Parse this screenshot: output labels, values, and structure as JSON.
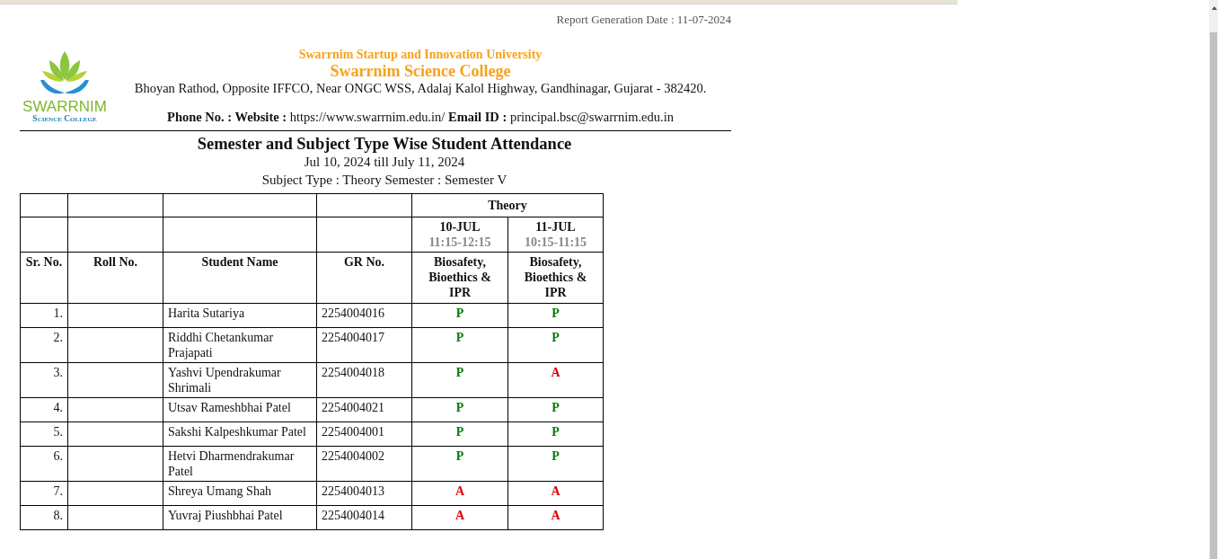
{
  "report_date": "Report Generation Date : 11-07-2024",
  "logo": {
    "line_1": "SWARRNIM",
    "line_2": "Science College"
  },
  "header": {
    "university": "Swarrnim Startup and Innovation University",
    "college": "Swarrnim Science College",
    "address": "Bhoyan Rathod, Opposite IFFCO, Near ONGC WSS, Adalaj Kalol Highway, Gandhinagar, Gujarat - 382420.",
    "contact": "**Phone No. :  Website :** https://www.swarrnim.edu.in/ **Email ID :** principal.bsc@swarrnim.edu.in"
  },
  "title": "Semester and Subject Type Wise Student Attendance",
  "date_range": "Jul 10, 2024 till July 11, 2024",
  "subtitle": "Subject Type : Theory Semester : Semester V",
  "table": {
    "group": "Theory",
    "sessions": [
      {
        "date": "10-JUL",
        "time": "11:15-12:15",
        "subject": "Biosafety, Bioethics & IPR"
      },
      {
        "date": "11-JUL",
        "time": "10:15-11:15",
        "subject": "Biosafety, Bioethics & IPR"
      }
    ],
    "columns": [
      "Sr. No.",
      "Roll No.",
      "Student Name",
      "GR No."
    ],
    "rows": [
      {
        "sr": "1.",
        "name": "Harita  Sutariya",
        "gr": "2254004016",
        "marks": [
          {
            "text": "P",
            "kind": "present"
          },
          {
            "text": "P",
            "kind": "present"
          }
        ]
      },
      {
        "sr": "2.",
        "name": "Riddhi Chetankumar Prajapati",
        "gr": "2254004017",
        "marks": [
          {
            "text": "P",
            "kind": "present"
          },
          {
            "text": "P",
            "kind": "present"
          }
        ]
      },
      {
        "sr": "3.",
        "name": "Yashvi Upendrakumar Shrimali",
        "gr": "2254004018",
        "marks": [
          {
            "text": "P",
            "kind": "present"
          },
          {
            "text": "A",
            "kind": "absent"
          }
        ]
      },
      {
        "sr": "4.",
        "name": "Utsav Rameshbhai Patel",
        "gr": "2254004021",
        "marks": [
          {
            "text": "P",
            "kind": "present"
          },
          {
            "text": "P",
            "kind": "present"
          }
        ]
      },
      {
        "sr": "5.",
        "name": "Sakshi Kalpeshkumar Patel",
        "gr": "2254004001",
        "marks": [
          {
            "text": "P",
            "kind": "present"
          },
          {
            "text": "P",
            "kind": "present"
          }
        ]
      },
      {
        "sr": "6.",
        "name": "Hetvi Dharmendrakumar Patel",
        "gr": "2254004002",
        "marks": [
          {
            "text": "P",
            "kind": "present"
          },
          {
            "text": "P",
            "kind": "present"
          }
        ]
      },
      {
        "sr": "7.",
        "name": "Shreya Umang Shah",
        "gr": "2254004013",
        "marks": [
          {
            "text": "A",
            "kind": "absent"
          },
          {
            "text": "A",
            "kind": "absent"
          }
        ]
      },
      {
        "sr": "8.",
        "name": "Yuvraj Piushbhai Patel",
        "gr": "2254004014",
        "marks": [
          {
            "text": "A",
            "kind": "absent"
          },
          {
            "text": "A",
            "kind": "absent"
          }
        ]
      }
    ]
  }
}
